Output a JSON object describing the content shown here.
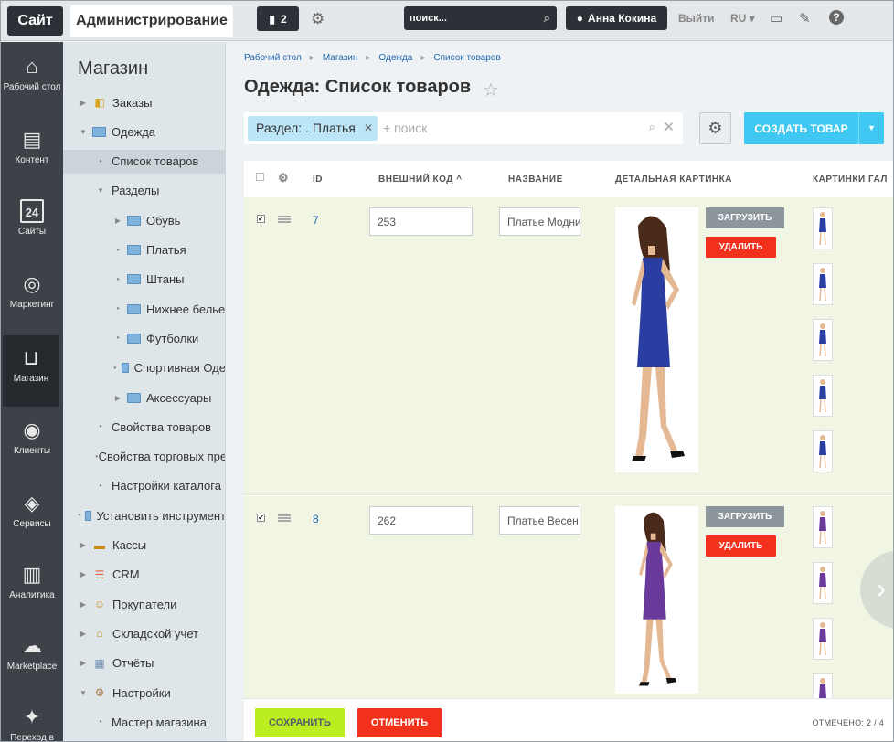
{
  "topbar": {
    "site": "Сайт",
    "admin": "Администрирование",
    "notifications": "2",
    "search_placeholder": "поиск...",
    "user": "Анна Кокина",
    "logout": "Выйти",
    "lang": "RU"
  },
  "leftnav": [
    {
      "label": "Рабочий стол",
      "icon": "home-icon",
      "glyph": "⌂"
    },
    {
      "label": "Контент",
      "icon": "document-icon",
      "glyph": "▤"
    },
    {
      "label": "Сайты",
      "icon": "calendar-icon",
      "glyph": "▣"
    },
    {
      "label": "Маркетинг",
      "icon": "target-icon",
      "glyph": "◎"
    },
    {
      "label": "Магазин",
      "icon": "basket-icon",
      "glyph": "⊔"
    },
    {
      "label": "Клиенты",
      "icon": "clients-icon",
      "glyph": "◉"
    },
    {
      "label": "Сервисы",
      "icon": "layers-icon",
      "glyph": "◈"
    },
    {
      "label": "Аналитика",
      "icon": "chart-icon",
      "glyph": "▥"
    },
    {
      "label": "Marketplace",
      "icon": "cloud-icon",
      "glyph": "☁"
    },
    {
      "label": "Переход в",
      "icon": "wand-icon",
      "glyph": "✦"
    }
  ],
  "calendar_number": "24",
  "sidebar": {
    "title": "Магазин",
    "items": [
      {
        "label": "Заказы",
        "icon": "bag-icon"
      },
      {
        "label": "Одежда",
        "icon": "folder-icon"
      },
      {
        "label": "Список товаров"
      },
      {
        "label": "Разделы"
      },
      {
        "label": "Обувь",
        "icon": "folder-icon"
      },
      {
        "label": "Платья",
        "icon": "folder-icon"
      },
      {
        "label": "Штаны",
        "icon": "folder-icon"
      },
      {
        "label": "Нижнее белье",
        "icon": "folder-icon"
      },
      {
        "label": "Футболки",
        "icon": "folder-icon"
      },
      {
        "label": "Спортивная Оде",
        "icon": "folder-icon"
      },
      {
        "label": "Аксессуары",
        "icon": "folder-icon"
      },
      {
        "label": "Свойства товаров"
      },
      {
        "label": "Свойства торговых пре"
      },
      {
        "label": "Настройки каталога"
      },
      {
        "label": "Установить инструмент",
        "icon": "folder-icon"
      },
      {
        "label": "Кассы",
        "icon": "cashbox-icon"
      },
      {
        "label": "CRM",
        "icon": "funnel-icon"
      },
      {
        "label": "Покупатели",
        "icon": "customers-icon"
      },
      {
        "label": "Складской учет",
        "icon": "warehouse-icon"
      },
      {
        "label": "Отчёты",
        "icon": "reports-icon"
      },
      {
        "label": "Настройки",
        "icon": "settings-icon"
      },
      {
        "label": "Мастер магазина"
      }
    ]
  },
  "breadcrumbs": [
    "Рабочий стол",
    "Магазин",
    "Одежда",
    "Список товаров"
  ],
  "page_title": "Одежда: Список товаров",
  "filter": {
    "chip": "Раздел: . Платья",
    "placeholder": "+ поиск"
  },
  "create_button": "СОЗДАТЬ ТОВАР",
  "grid": {
    "columns": [
      "ID",
      "ВНЕШНИЙ КОД",
      "НАЗВАНИЕ",
      "ДЕТАЛЬНАЯ КАРТИНКА",
      "КАРТИНКИ ГАЛ"
    ],
    "upload_label": "ЗАГРУЗИТЬ",
    "delete_label": "УДАЛИТЬ",
    "rows": [
      {
        "id": "7",
        "ext_code": "253",
        "name": "Платье Модни",
        "dress_color": "#2a3da0",
        "thumb_count": 5
      },
      {
        "id": "8",
        "ext_code": "262",
        "name": "Платье Весен",
        "dress_color": "#6a3a9a",
        "thumb_count": 4
      }
    ]
  },
  "footer": {
    "save": "СОХРАНИТЬ",
    "cancel": "ОТМЕНИТЬ",
    "selected": "ОТМЕЧЕНО: 2 / 4"
  },
  "colors": {
    "accent": "#3fc8f2",
    "save": "#bbed21",
    "danger": "#f2311c",
    "row_bg": "#f1f6e4"
  }
}
